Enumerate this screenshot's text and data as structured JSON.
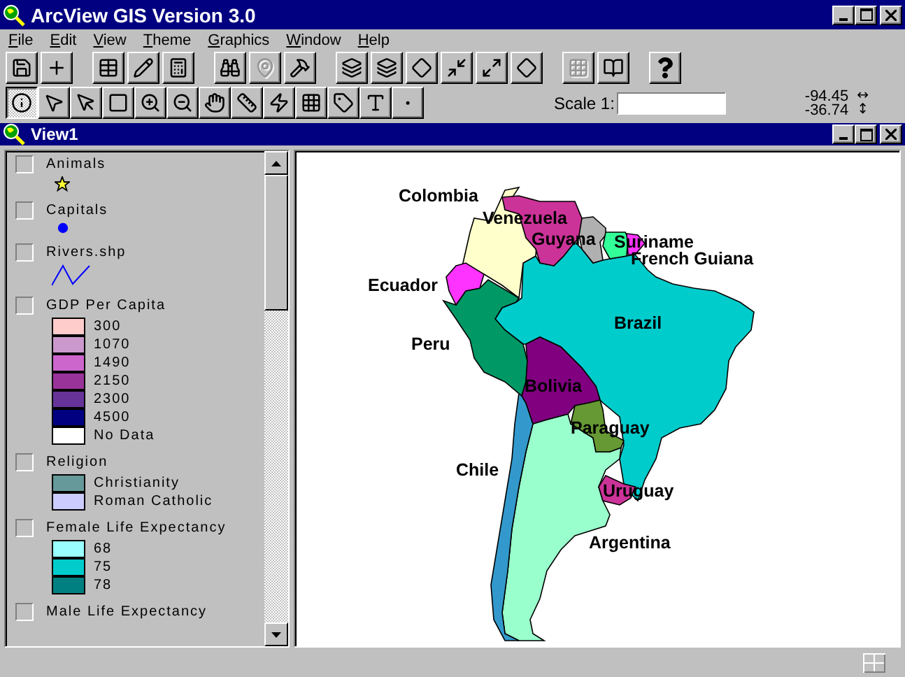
{
  "window": {
    "title": "ArcView GIS Version 3.0"
  },
  "menu": [
    "File",
    "Edit",
    "View",
    "Theme",
    "Graphics",
    "Window",
    "Help"
  ],
  "buttons": [
    {
      "disabled": false
    },
    {
      "disabled": false
    },
    {
      "disabled": false
    },
    {
      "disabled": false
    },
    {
      "disabled": false
    },
    {
      "disabled": false
    },
    {
      "disabled": true
    },
    {
      "disabled": false
    },
    {
      "disabled": false
    },
    {
      "disabled": false
    },
    {
      "disabled": false
    },
    {
      "disabled": false
    },
    {
      "disabled": false
    },
    {
      "disabled": false
    },
    {
      "disabled": true
    },
    {
      "disabled": false
    },
    {
      "disabled": false
    }
  ],
  "tools": [
    {
      "selected": true
    },
    {
      "selected": false
    },
    {
      "selected": false
    },
    {
      "selected": false
    },
    {
      "selected": false
    },
    {
      "selected": false
    },
    {
      "selected": false
    },
    {
      "selected": false
    },
    {
      "selected": false
    },
    {
      "selected": false
    },
    {
      "selected": false
    },
    {
      "selected": false
    },
    {
      "selected": false
    }
  ],
  "scale": {
    "label": "Scale 1:"
  },
  "coordinates": [
    {
      "value": "-94.45",
      "arrow": "↔"
    },
    {
      "value": "-36.74",
      "arrow": "↕"
    }
  ],
  "view": {
    "title": "View1"
  },
  "legend": [
    {
      "kind": "point",
      "name": "Animals",
      "checked": false
    },
    {
      "kind": "marker",
      "name": "Capitals",
      "checked": false
    },
    {
      "kind": "line",
      "name": "Rivers.shp",
      "checked": false
    },
    {
      "kind": "classes",
      "name": "GDP Per Capita",
      "checked": false,
      "classes": [
        {
          "label": "300",
          "color": "#ffcccc"
        },
        {
          "label": "1070",
          "color": "#cc99cc"
        },
        {
          "label": "1490",
          "color": "#cc66cc"
        },
        {
          "label": "2150",
          "color": "#993399"
        },
        {
          "label": "2300",
          "color": "#663399"
        },
        {
          "label": "4500",
          "color": "#000080"
        },
        {
          "label": "No Data",
          "color": "#ffffff"
        }
      ]
    },
    {
      "kind": "classes",
      "name": "Religion",
      "checked": false,
      "classes": [
        {
          "label": "Christianity",
          "color": "#669999"
        },
        {
          "label": "Roman Catholic",
          "color": "#ccccff"
        }
      ]
    },
    {
      "kind": "classes",
      "name": "Female Life Expectancy",
      "checked": false,
      "classes": [
        {
          "label": "68",
          "color": "#99ffff"
        },
        {
          "label": "75",
          "color": "#00cccc"
        },
        {
          "label": "78",
          "color": "#008080"
        }
      ]
    },
    {
      "kind": "classes",
      "name": "Male Life Expectancy",
      "checked": false
    }
  ],
  "map": {
    "countries": [
      {
        "name": "Colombia",
        "color": "#ffffcc"
      },
      {
        "name": "Venezuela",
        "color": "#cc3399"
      },
      {
        "name": "Guyana",
        "color": "#b0b0b0"
      },
      {
        "name": "Suriname",
        "color": "#33ff99"
      },
      {
        "name": "French Guiana",
        "color": "#ff33ff"
      },
      {
        "name": "Ecuador",
        "color": "#ff33ff"
      },
      {
        "name": "Peru",
        "color": "#009966"
      },
      {
        "name": "Brazil",
        "color": "#00cccc"
      },
      {
        "name": "Bolivia",
        "color": "#800080"
      },
      {
        "name": "Paraguay",
        "color": "#669933"
      },
      {
        "name": "Chile",
        "color": "#3399cc"
      },
      {
        "name": "Uruguay",
        "color": "#cc3399"
      },
      {
        "name": "Argentina",
        "color": "#99ffcc"
      }
    ]
  }
}
